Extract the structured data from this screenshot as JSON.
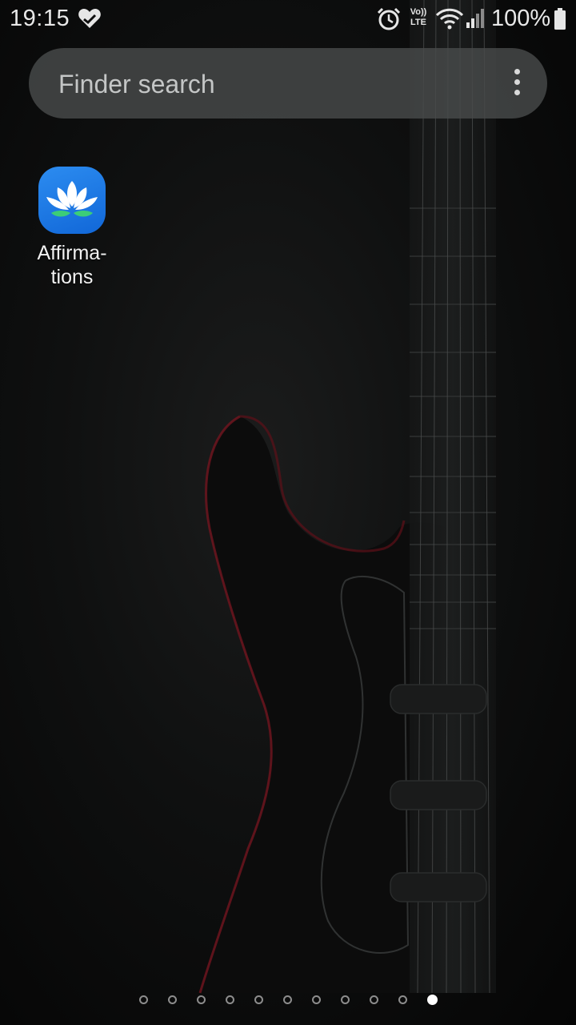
{
  "status_bar": {
    "time": "19:15",
    "battery_percent": "100%",
    "volte_label_top": "Vo))",
    "volte_label_bottom": "LTE",
    "icons": [
      "heart-icon",
      "alarm-icon",
      "volte-icon",
      "wifi-icon",
      "signal-icon",
      "battery-icon"
    ]
  },
  "search": {
    "placeholder": "Finder search",
    "menu_icon": "more-vertical-icon"
  },
  "apps": [
    {
      "label": "Affirma-\ntions",
      "icon": "lotus-icon",
      "accent": "#1a78e6"
    }
  ],
  "pager": {
    "page_count": 11,
    "current_page": 11
  },
  "wallpaper": "electric guitar silhouette on dark background",
  "colors": {
    "background": "#0a0a0a",
    "search_bar": "#484a4a",
    "app_icon": "#1a78e6",
    "lotus_leaf": "#3ccd78",
    "guitar_edge": "#8a1620"
  }
}
